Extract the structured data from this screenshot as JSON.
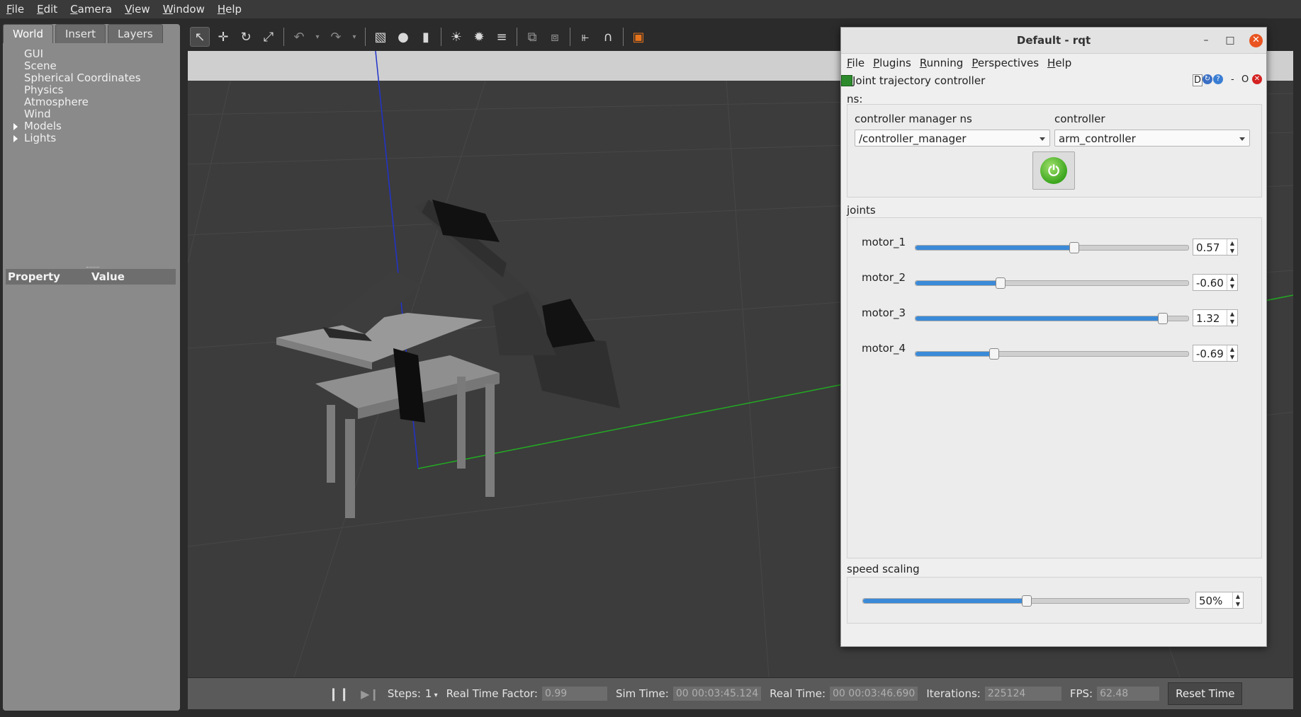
{
  "gazebo": {
    "menu": [
      {
        "pre": "",
        "u": "F",
        "post": "ile"
      },
      {
        "pre": "",
        "u": "E",
        "post": "dit"
      },
      {
        "pre": "",
        "u": "C",
        "post": "amera"
      },
      {
        "pre": "",
        "u": "V",
        "post": "iew"
      },
      {
        "pre": "",
        "u": "W",
        "post": "indow"
      },
      {
        "pre": "",
        "u": "H",
        "post": "elp"
      }
    ],
    "tabs": [
      "World",
      "Insert",
      "Layers"
    ],
    "tree": [
      "GUI",
      "Scene",
      "Spherical Coordinates",
      "Physics",
      "Atmosphere",
      "Wind",
      "Models",
      "Lights"
    ],
    "property_header": {
      "property": "Property",
      "value": "Value"
    },
    "status": {
      "steps_label": "Steps:",
      "steps_value": "1",
      "rtf_label": "Real Time Factor:",
      "rtf_value": "0.99",
      "sim_label": "Sim Time:",
      "sim_value": "00 00:03:45.124",
      "real_label": "Real Time:",
      "real_value": "00 00:03:46.690",
      "iter_label": "Iterations:",
      "iter_value": "225124",
      "fps_label": "FPS:",
      "fps_value": "62.48",
      "reset_label": "Reset Time"
    }
  },
  "rqt": {
    "title": "Default - rqt",
    "menu": [
      {
        "u": "F",
        "post": "ile"
      },
      {
        "u": "P",
        "post": "lugins"
      },
      {
        "u": "R",
        "post": "unning"
      },
      {
        "u": "P",
        "post": "erspectives"
      },
      {
        "u": "H",
        "post": "elp"
      }
    ],
    "plugin_title": "Joint trajectory controller",
    "plugin_controls": {
      "d": "D",
      "min": "-",
      "o": "O"
    },
    "ns_label": "ns:",
    "cm_ns_label": "controller manager ns",
    "cm_ns_value": "/controller_manager",
    "controller_label": "controller",
    "controller_value": "arm_controller",
    "joints_label": "joints",
    "joints": [
      {
        "name": "motor_1",
        "value": "0.57",
        "level": 0.58
      },
      {
        "name": "motor_2",
        "value": "-0.60",
        "level": 0.31
      },
      {
        "name": "motor_3",
        "value": "1.32",
        "level": 0.905
      },
      {
        "name": "motor_4",
        "value": "-0.69",
        "level": 0.285
      }
    ],
    "speed_label": "speed scaling",
    "speed_value": "50%",
    "speed_level": 0.5,
    "accent": "#3b8ad8"
  }
}
